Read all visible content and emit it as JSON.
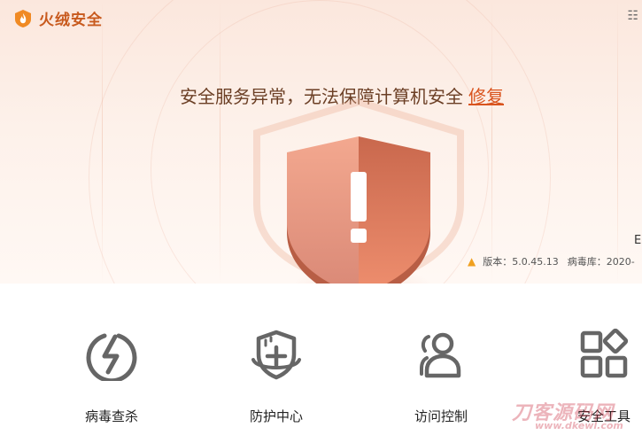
{
  "app": {
    "name": "火绒安全",
    "brand_color": "#c85a1e"
  },
  "header": {
    "menu_icon": "list-menu-icon"
  },
  "status": {
    "message": "安全服务异常，无法保障计算机安全",
    "action_label": "修复",
    "action_color": "#d9541e",
    "shield_state": "warning-exclamation"
  },
  "info": {
    "side_char": "E",
    "version_label": "版本：5.0.45.13",
    "virus_db_label": "病毒库：2020-",
    "update_icon": "up-arrow-icon"
  },
  "tools": [
    {
      "label": "病毒查杀",
      "icon": "lightning-scan-icon"
    },
    {
      "label": "防护中心",
      "icon": "shield-plus-icon"
    },
    {
      "label": "访问控制",
      "icon": "users-icon"
    },
    {
      "label": "安全工具",
      "icon": "grid-shapes-icon"
    }
  ],
  "watermark": {
    "main": "刀客源码网",
    "sub": "www.dkewl.com"
  }
}
